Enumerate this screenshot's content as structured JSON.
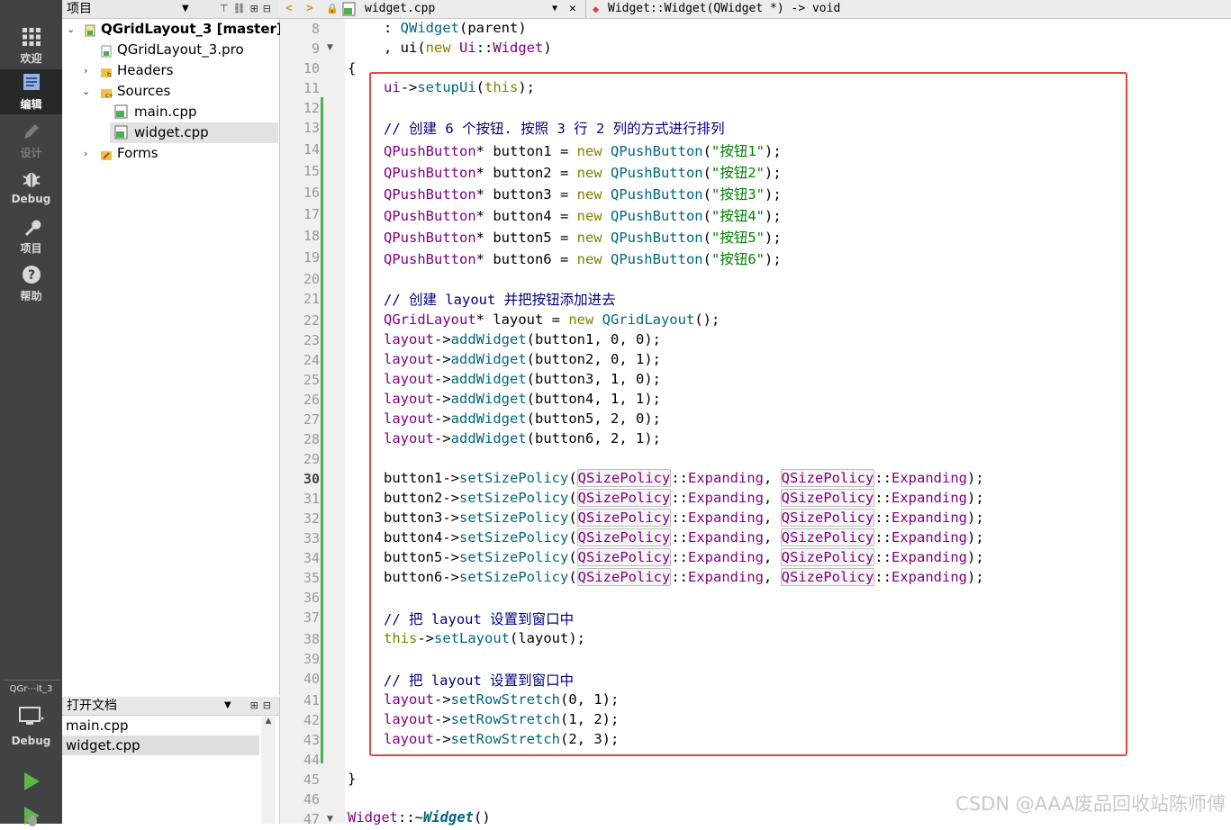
{
  "mode_bar": {
    "items": [
      {
        "label": "欢迎",
        "icon": "grid-icon"
      },
      {
        "label": "编辑",
        "icon": "edit-icon",
        "active": true
      },
      {
        "label": "设计",
        "icon": "pencil-icon",
        "disabled": true
      },
      {
        "label": "Debug",
        "icon": "bug-icon"
      },
      {
        "label": "项目",
        "icon": "wrench-icon"
      },
      {
        "label": "帮助",
        "icon": "help-icon"
      }
    ],
    "kit": "QGr⋯it_3",
    "build_mode": "Debug"
  },
  "project_pane": {
    "title": "项目",
    "tree": {
      "root": "QGridLayout_3 [master]",
      "pro": "QGridLayout_3.pro",
      "headers": "Headers",
      "sources": "Sources",
      "main": "main.cpp",
      "widget": "widget.cpp",
      "forms": "Forms"
    }
  },
  "open_docs": {
    "title": "打开文档",
    "items": [
      "main.cpp",
      "widget.cpp"
    ]
  },
  "editor": {
    "file": "widget.cpp",
    "symbol": "Widget::Widget(QWidget *) -> void",
    "line_numbers": [
      8,
      9,
      10,
      11,
      12,
      13,
      14,
      15,
      16,
      17,
      18,
      19,
      20,
      21,
      22,
      23,
      24,
      25,
      26,
      27,
      28,
      29,
      30,
      31,
      32,
      33,
      34,
      35,
      36,
      37,
      38,
      39,
      40,
      41,
      42,
      43,
      44,
      45,
      46,
      47
    ],
    "current_line": 30,
    "comments": {
      "c1": "// 创建 6 个按钮. 按照 3 行 2 列的方式进行排列",
      "c2": "// 创建 layout 并把按钮添加进去",
      "c3": "// 把 layout 设置到窗口中",
      "c4": "// 把 layout 设置到窗口中"
    },
    "buttons": [
      "button1",
      "button2",
      "button3",
      "button4",
      "button5",
      "button6"
    ],
    "button_texts": [
      "\"按钮1\"",
      "\"按钮2\"",
      "\"按钮3\"",
      "\"按钮4\"",
      "\"按钮5\"",
      "\"按钮6\""
    ],
    "grid_positions": [
      "0, 0",
      "0, 1",
      "1, 0",
      "1, 1",
      "2, 0",
      "2, 1"
    ],
    "stretches": [
      "0, 1",
      "1, 2",
      "2, 3"
    ]
  },
  "watermark": "CSDN @AAA废品回收站陈师傅"
}
